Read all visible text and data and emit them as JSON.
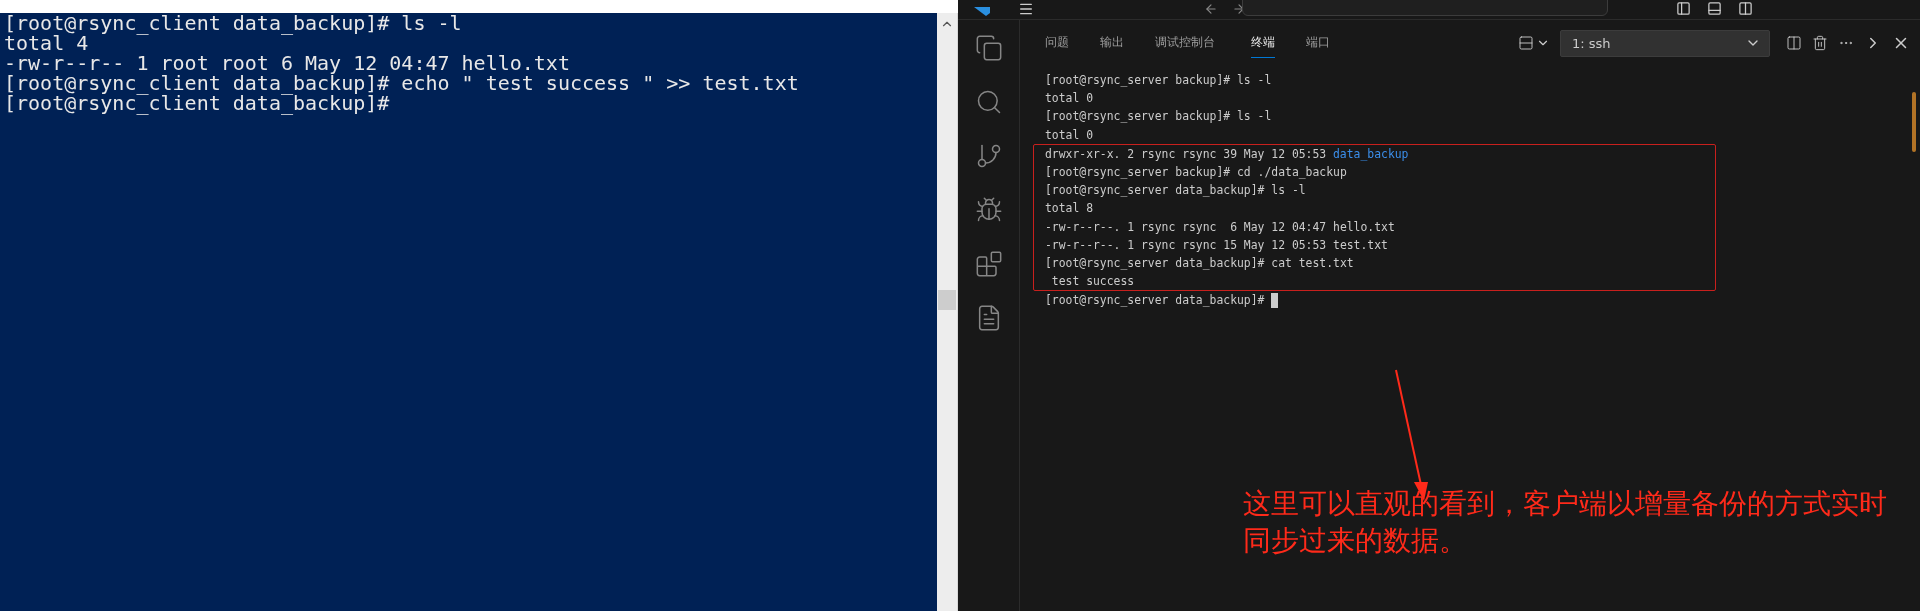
{
  "client_terminal": {
    "lines": [
      {
        "text": "[root@rsync_client data_backup]# ls -l"
      },
      {
        "text": "total 4"
      },
      {
        "text": "-rw-r--r-- 1 root root 6 May 12 04:47 hello.txt"
      },
      {
        "text": "[root@rsync_client data_backup]# echo \" test success \" >> test.txt"
      },
      {
        "text": "[root@rsync_client data_backup]#"
      }
    ]
  },
  "editor": {
    "panel_tabs": [
      {
        "label": "问题",
        "selected": false
      },
      {
        "label": "输出",
        "selected": false
      },
      {
        "label": "调试控制台",
        "selected": false
      },
      {
        "label": "终端",
        "selected": true
      },
      {
        "label": "端口",
        "selected": false
      }
    ],
    "terminal_select": {
      "value": "1: ssh"
    },
    "terminal": {
      "lines_before": [
        {
          "text": "[root@rsync_server backup]# ls -l"
        },
        {
          "text": "total 0"
        },
        {
          "text": "[root@rsync_server backup]# ls -l"
        },
        {
          "text": "total 0"
        }
      ],
      "highlighted_lines": [
        {
          "text": "drwxr-xr-x. 2 rsync rsync 39 May 12 05:53",
          "directory": "data_backup"
        },
        {
          "text": "[root@rsync_server backup]# cd ./data_backup"
        },
        {
          "text": "[root@rsync_server data_backup]# ls -l"
        },
        {
          "text": "total 8"
        },
        {
          "text": "-rw-r--r--. 1 rsync rsync  6 May 12 04:47 hello.txt"
        },
        {
          "text": "-rw-r--r--. 1 rsync rsync 15 May 12 05:53 test.txt"
        },
        {
          "text": "[root@rsync_server data_backup]# cat test.txt"
        },
        {
          "text": " test success"
        }
      ],
      "prompt": {
        "text": "[root@rsync_server data_backup]#",
        "cursor": true
      }
    }
  },
  "annotation": {
    "lines": [
      "这里可以直观的看到，客户端以增量备份的方式实时",
      "同步过来的数据。"
    ]
  }
}
